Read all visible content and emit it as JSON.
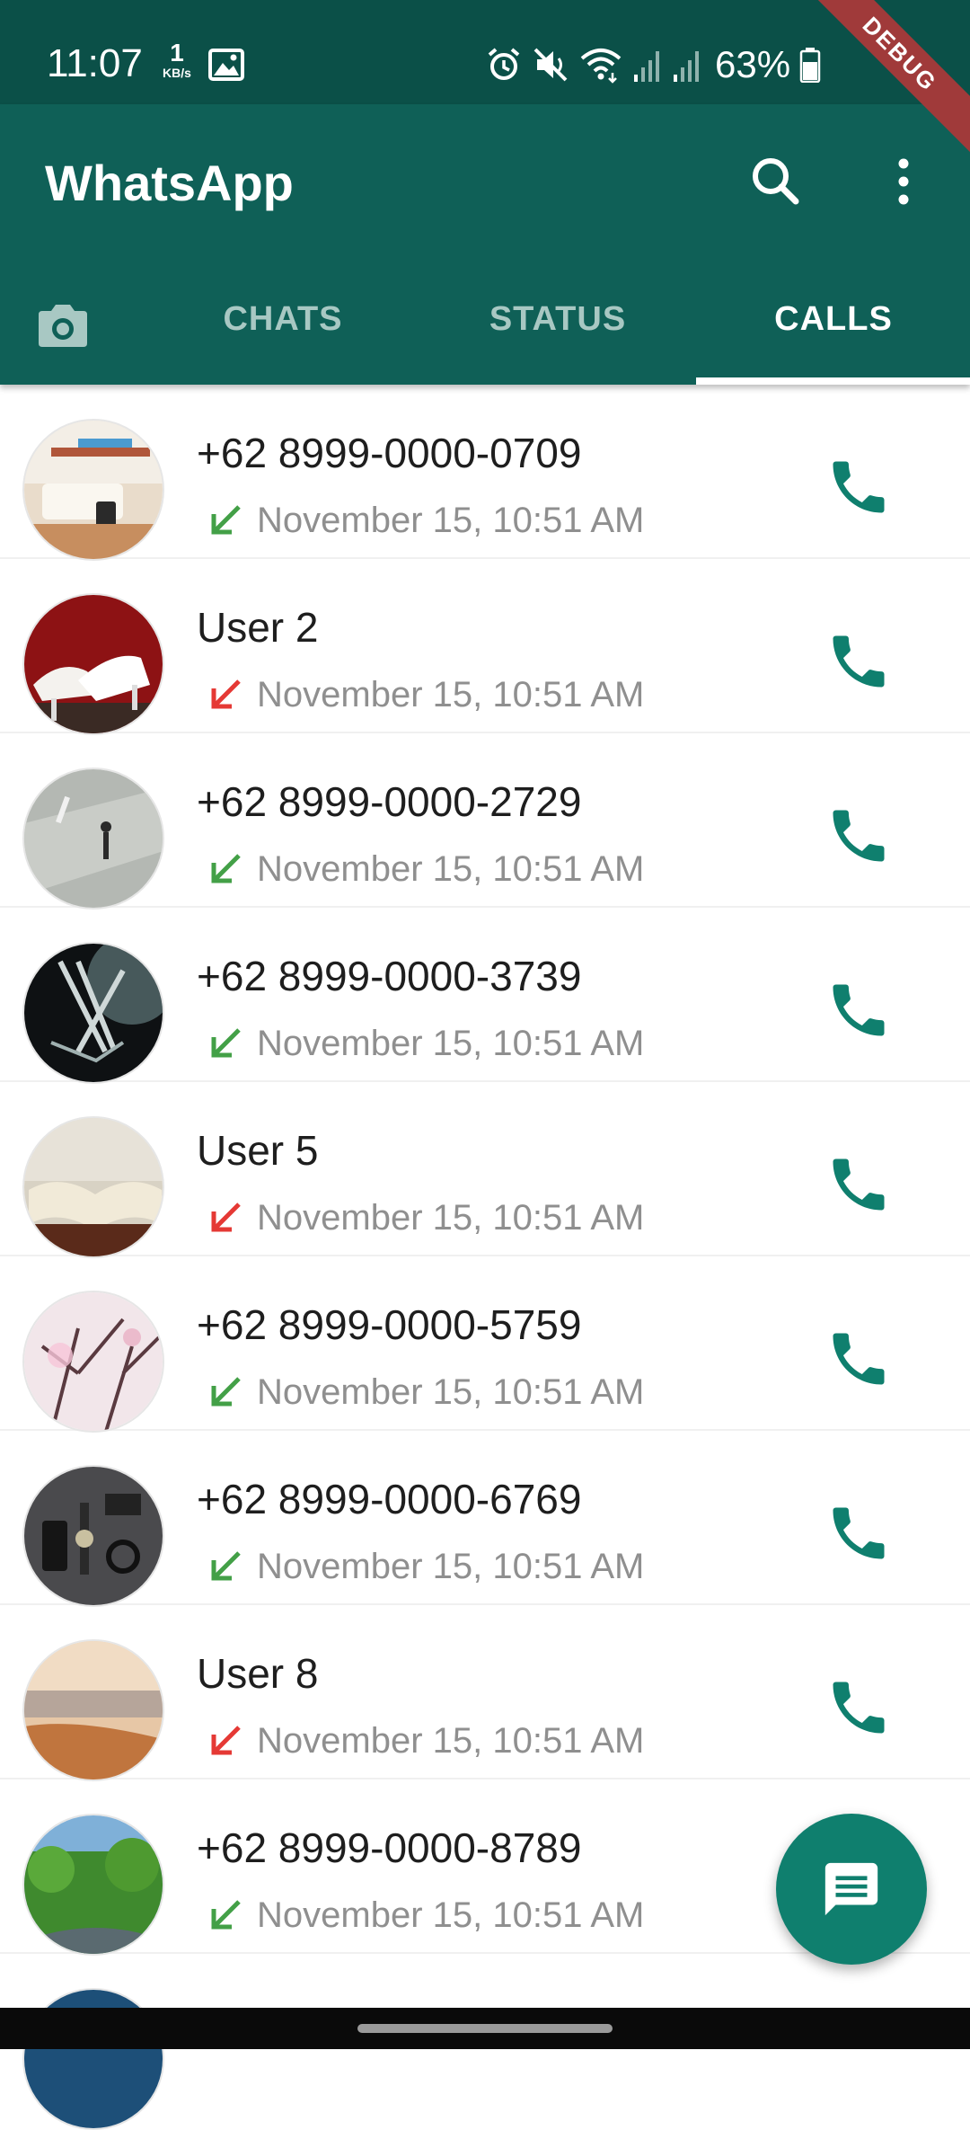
{
  "status_bar": {
    "time": "11:07",
    "net_speed": "1",
    "net_unit": "KB/s",
    "battery": "63%",
    "debug_label": "DEBUG"
  },
  "app_bar": {
    "title": "WhatsApp",
    "tabs": [
      {
        "label": "CHATS",
        "active": false
      },
      {
        "label": "STATUS",
        "active": false
      },
      {
        "label": "CALLS",
        "active": true
      }
    ]
  },
  "calls": [
    {
      "name": "+62 8999-0000-0709",
      "time": "November 15, 10:51 AM",
      "direction": "incoming",
      "arrow_color": "#43a047"
    },
    {
      "name": "User 2",
      "time": "November 15, 10:51 AM",
      "direction": "missed",
      "arrow_color": "#e53935"
    },
    {
      "name": "+62 8999-0000-2729",
      "time": "November 15, 10:51 AM",
      "direction": "incoming",
      "arrow_color": "#43a047"
    },
    {
      "name": "+62 8999-0000-3739",
      "time": "November 15, 10:51 AM",
      "direction": "incoming",
      "arrow_color": "#43a047"
    },
    {
      "name": "User 5",
      "time": "November 15, 10:51 AM",
      "direction": "missed",
      "arrow_color": "#e53935"
    },
    {
      "name": "+62 8999-0000-5759",
      "time": "November 15, 10:51 AM",
      "direction": "incoming",
      "arrow_color": "#43a047"
    },
    {
      "name": "+62 8999-0000-6769",
      "time": "November 15, 10:51 AM",
      "direction": "incoming",
      "arrow_color": "#43a047"
    },
    {
      "name": "User 8",
      "time": "November 15, 10:51 AM",
      "direction": "missed",
      "arrow_color": "#e53935"
    },
    {
      "name": "+62 8999-0000-8789",
      "time": "November 15, 10:51 AM",
      "direction": "incoming",
      "arrow_color": "#43a047"
    }
  ],
  "colors": {
    "status_bar": "#0b5048",
    "app_bar": "#0f6057",
    "accent": "#0f7f6e",
    "incoming": "#43a047",
    "missed": "#e53935"
  },
  "icons": {
    "search": "search-icon",
    "menu": "more-vert-icon",
    "camera": "camera-icon",
    "call": "phone-icon",
    "fab": "message-icon"
  }
}
